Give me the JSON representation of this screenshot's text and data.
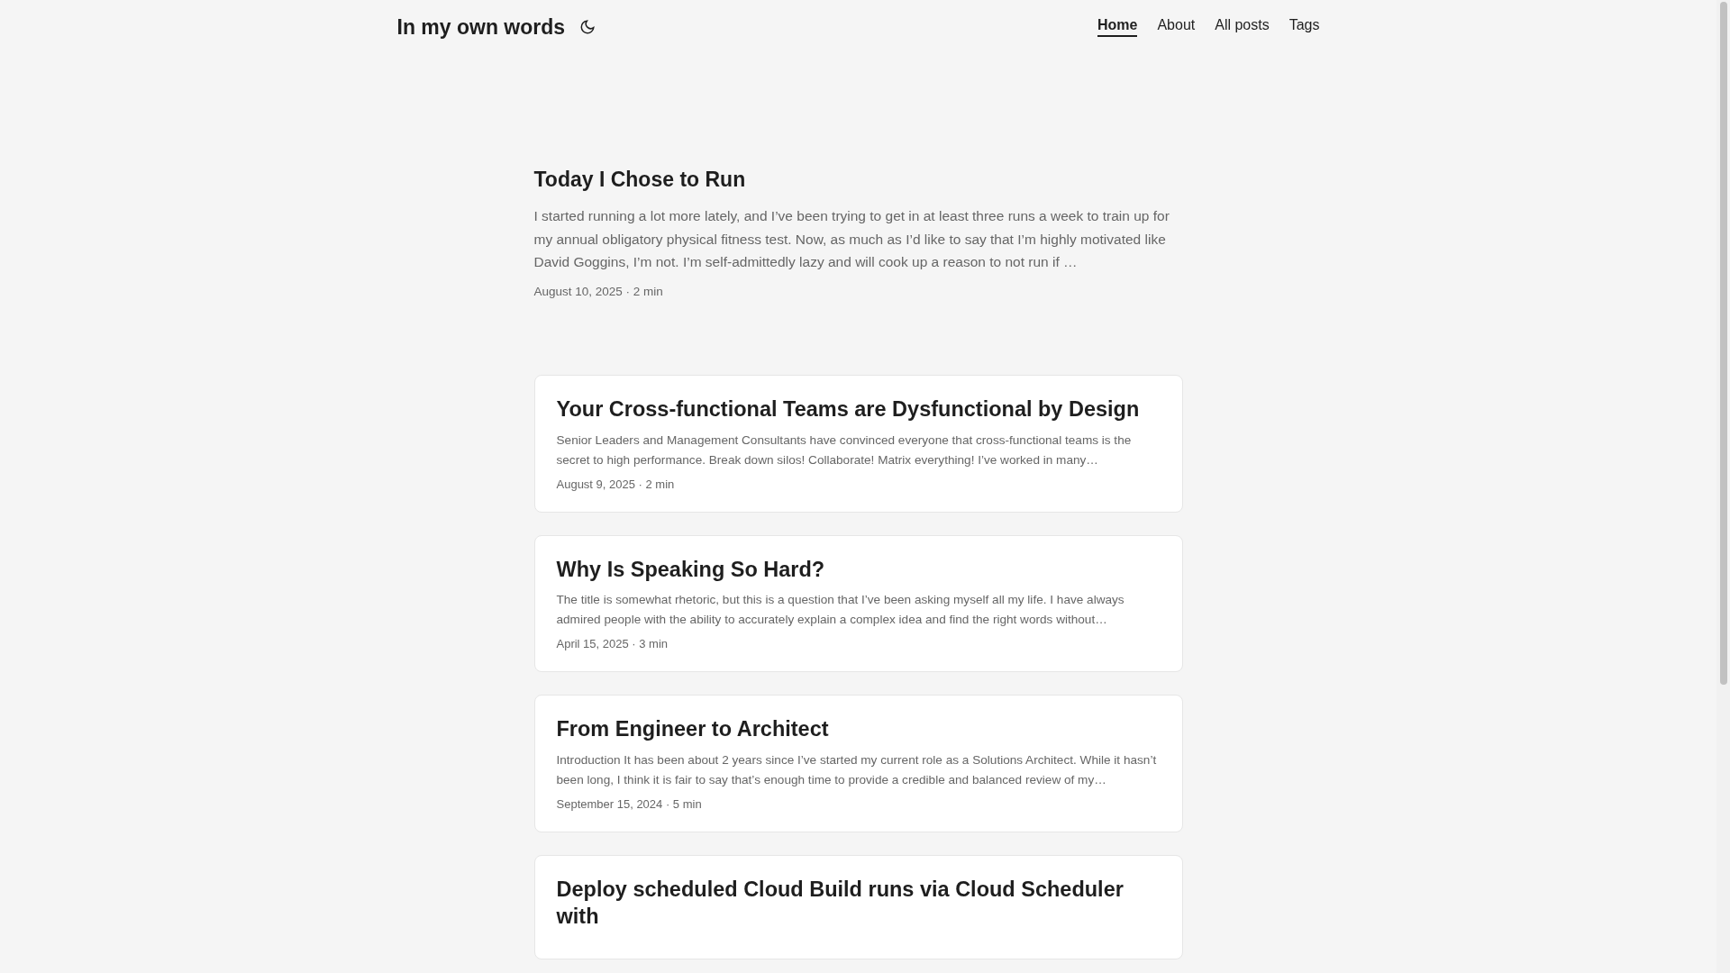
{
  "site_title": "In my own words",
  "nav": [
    {
      "label": "Home",
      "selected": true
    },
    {
      "label": "About",
      "selected": false
    },
    {
      "label": "All posts",
      "selected": false
    },
    {
      "label": "Tags",
      "selected": false
    }
  ],
  "featured": {
    "title": "Today I Chose to Run",
    "excerpt": "I started running a lot more lately, and I’ve been trying to get in at least three runs a week to train up for my annual obligatory physical fitness test. Now, as much as I’d like to say that I’m highly motivated like David Goggins, I’m not. I’m self-admittedly lazy and will cook up a reason to not run if …",
    "meta": "August 10, 2025 · 2 min"
  },
  "posts": [
    {
      "title": "Your Cross-functional Teams are Dysfunctional by Design",
      "excerpt": "Senior Leaders and Management Consultants have convinced everyone that cross-functional teams is the secret to high performance. Break down silos! Collaborate! Matrix everything! I’ve worked in many…",
      "meta": "August 9, 2025 · 2 min"
    },
    {
      "title": "Why Is Speaking So Hard?",
      "excerpt": "The title is somewhat rhetoric, but this is a question that I’ve been asking myself all my life. I have always admired people with the ability to accurately explain a complex idea and find the right words without…",
      "meta": "April 15, 2025 · 3 min"
    },
    {
      "title": "From Engineer to Architect",
      "excerpt": "Introduction It has been about 2 years since I’ve started my current role as a Solutions Architect. While it hasn’t been long, I think it is fair to say that’s enough time to provide a credible and balanced review of my…",
      "meta": "September 15, 2024 · 5 min"
    },
    {
      "title": "Deploy scheduled Cloud Build runs via Cloud Scheduler with"
    }
  ]
}
